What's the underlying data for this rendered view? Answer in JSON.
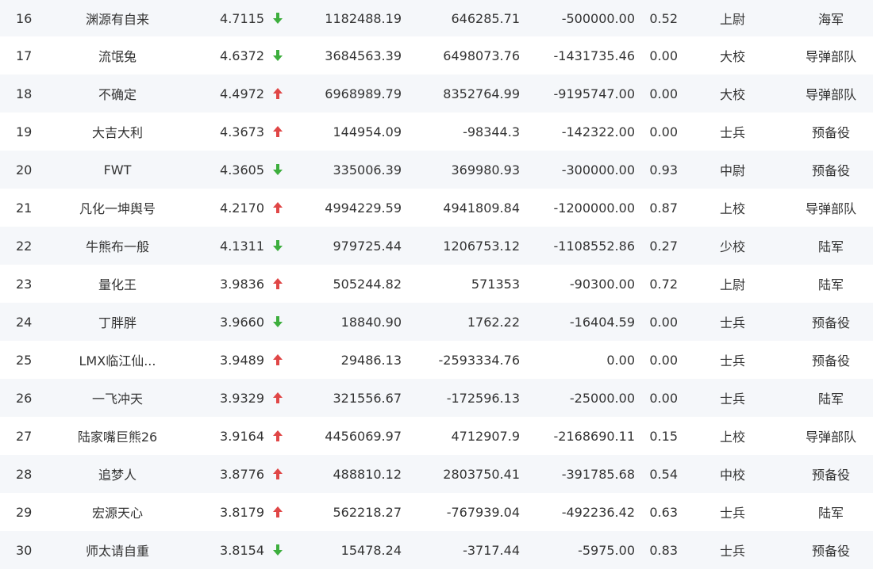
{
  "colors": {
    "up": "#e04646",
    "down": "#3dae3d",
    "row_alt": "#f5f7fa"
  },
  "rows": [
    {
      "rank": "16",
      "name": "渊源有自来",
      "score": "4.7115",
      "trend": "down",
      "value1": "1182488.19",
      "value2": "646285.71",
      "value3": "-500000.00",
      "ratio": "0.52",
      "level": "上尉",
      "unit": "海军"
    },
    {
      "rank": "17",
      "name": "流氓兔",
      "score": "4.6372",
      "trend": "down",
      "value1": "3684563.39",
      "value2": "6498073.76",
      "value3": "-1431735.46",
      "ratio": "0.00",
      "level": "大校",
      "unit": "导弹部队"
    },
    {
      "rank": "18",
      "name": "不确定",
      "score": "4.4972",
      "trend": "up",
      "value1": "6968989.79",
      "value2": "8352764.99",
      "value3": "-9195747.00",
      "ratio": "0.00",
      "level": "大校",
      "unit": "导弹部队"
    },
    {
      "rank": "19",
      "name": "大吉大利",
      "score": "4.3673",
      "trend": "up",
      "value1": "144954.09",
      "value2": "-98344.3",
      "value3": "-142322.00",
      "ratio": "0.00",
      "level": "士兵",
      "unit": "预备役"
    },
    {
      "rank": "20",
      "name": "FWT",
      "score": "4.3605",
      "trend": "down",
      "value1": "335006.39",
      "value2": "369980.93",
      "value3": "-300000.00",
      "ratio": "0.93",
      "level": "中尉",
      "unit": "预备役"
    },
    {
      "rank": "21",
      "name": "凡化一坤舆号",
      "score": "4.2170",
      "trend": "up",
      "value1": "4994229.59",
      "value2": "4941809.84",
      "value3": "-1200000.00",
      "ratio": "0.87",
      "level": "上校",
      "unit": "导弹部队"
    },
    {
      "rank": "22",
      "name": "牛熊布一般",
      "score": "4.1311",
      "trend": "down",
      "value1": "979725.44",
      "value2": "1206753.12",
      "value3": "-1108552.86",
      "ratio": "0.27",
      "level": "少校",
      "unit": "陆军"
    },
    {
      "rank": "23",
      "name": "量化王",
      "score": "3.9836",
      "trend": "up",
      "value1": "505244.82",
      "value2": "571353",
      "value3": "-90300.00",
      "ratio": "0.72",
      "level": "上尉",
      "unit": "陆军"
    },
    {
      "rank": "24",
      "name": "丁胖胖",
      "score": "3.9660",
      "trend": "down",
      "value1": "18840.90",
      "value2": "1762.22",
      "value3": "-16404.59",
      "ratio": "0.00",
      "level": "士兵",
      "unit": "预备役"
    },
    {
      "rank": "25",
      "name": "LMX临江仙...",
      "score": "3.9489",
      "trend": "up",
      "value1": "29486.13",
      "value2": "-2593334.76",
      "value3": "0.00",
      "ratio": "0.00",
      "level": "士兵",
      "unit": "预备役"
    },
    {
      "rank": "26",
      "name": "一飞冲天",
      "score": "3.9329",
      "trend": "up",
      "value1": "321556.67",
      "value2": "-172596.13",
      "value3": "-25000.00",
      "ratio": "0.00",
      "level": "士兵",
      "unit": "陆军"
    },
    {
      "rank": "27",
      "name": "陆家嘴巨熊26",
      "score": "3.9164",
      "trend": "up",
      "value1": "4456069.97",
      "value2": "4712907.9",
      "value3": "-2168690.11",
      "ratio": "0.15",
      "level": "上校",
      "unit": "导弹部队"
    },
    {
      "rank": "28",
      "name": "追梦人",
      "score": "3.8776",
      "trend": "up",
      "value1": "488810.12",
      "value2": "2803750.41",
      "value3": "-391785.68",
      "ratio": "0.54",
      "level": "中校",
      "unit": "预备役"
    },
    {
      "rank": "29",
      "name": "宏源天心",
      "score": "3.8179",
      "trend": "up",
      "value1": "562218.27",
      "value2": "-767939.04",
      "value3": "-492236.42",
      "ratio": "0.63",
      "level": "士兵",
      "unit": "陆军"
    },
    {
      "rank": "30",
      "name": "师太请自重",
      "score": "3.8154",
      "trend": "down",
      "value1": "15478.24",
      "value2": "-3717.44",
      "value3": "-5975.00",
      "ratio": "0.83",
      "level": "士兵",
      "unit": "预备役"
    }
  ]
}
